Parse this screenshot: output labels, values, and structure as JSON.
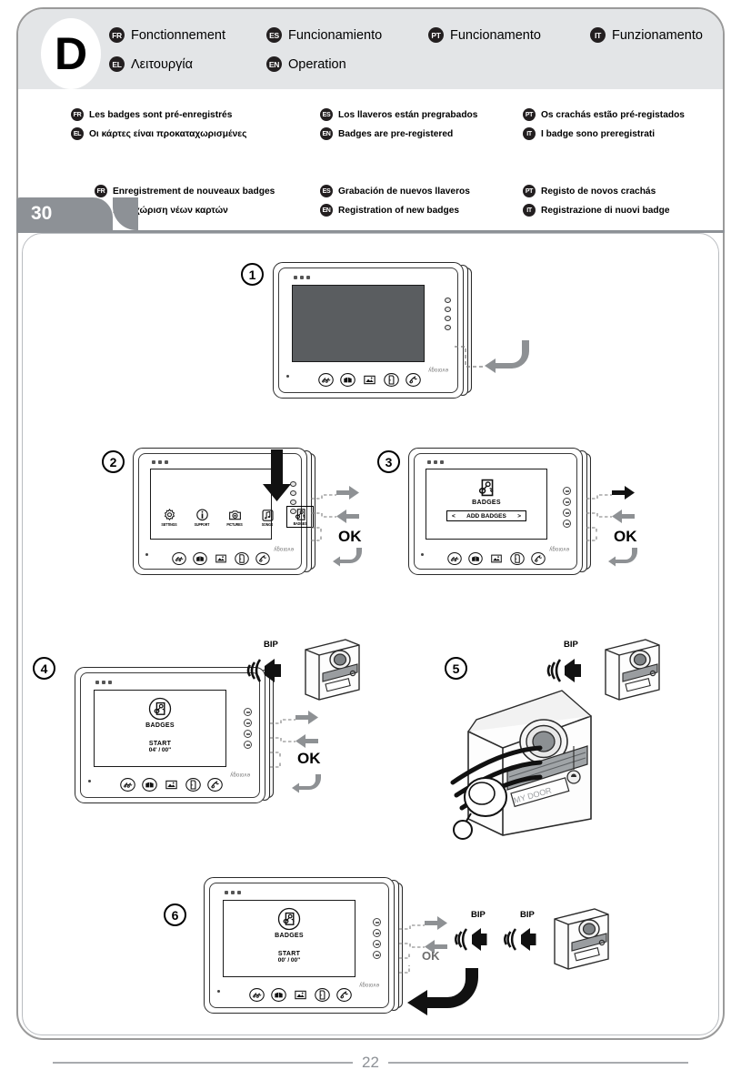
{
  "page": {
    "section_letter": "D",
    "tab_number": "30",
    "footer_page": "22"
  },
  "header": {
    "items": [
      {
        "lang": "FR",
        "label": "Fonctionnement"
      },
      {
        "lang": "ES",
        "label": "Funcionamiento"
      },
      {
        "lang": "PT",
        "label": "Funcionamento"
      },
      {
        "lang": "IT",
        "label": "Funzionamento"
      },
      {
        "lang": "EL",
        "label": "Λειτουργία"
      },
      {
        "lang": "EN",
        "label": "Operation"
      }
    ]
  },
  "subtitle_a": {
    "items": [
      {
        "lang": "FR",
        "label": "Les badges sont pré-enregistrés"
      },
      {
        "lang": "EL",
        "label": "Οι κάρτες είναι προκαταχωρισμένες"
      },
      {
        "lang": "ES",
        "label": "Los llaveros están pregrabados"
      },
      {
        "lang": "EN",
        "label": "Badges are pre-registered"
      },
      {
        "lang": "PT",
        "label": "Os crachás estão pré-registados"
      },
      {
        "lang": "IT",
        "label": "I badge sono preregistrati"
      }
    ]
  },
  "subtitle_b": {
    "items": [
      {
        "lang": "FR",
        "label": "Enregistrement de nouveaux badges"
      },
      {
        "lang": "EL",
        "label": "Καταχώριση νέων καρτών"
      },
      {
        "lang": "ES",
        "label": "Grabación de nuevos llaveros"
      },
      {
        "lang": "EN",
        "label": "Registration of new badges"
      },
      {
        "lang": "PT",
        "label": "Registo de novos crachás"
      },
      {
        "lang": "IT",
        "label": "Registrazione di nuovi badge"
      }
    ]
  },
  "steps": {
    "s1": {
      "number": "1"
    },
    "s2": {
      "number": "2",
      "ok_label": "OK",
      "menu": [
        {
          "icon": "gear-icon",
          "label": "SETTINGS"
        },
        {
          "icon": "info-icon",
          "label": "SUPPORT"
        },
        {
          "icon": "camera-icon",
          "label": "PICTURES"
        },
        {
          "icon": "music-note-icon",
          "label": "SONGS"
        },
        {
          "icon": "badge-icon",
          "label": "BADGES"
        }
      ],
      "selected": "BADGES"
    },
    "s3": {
      "number": "3",
      "screen_title": "BADGES",
      "action_label": "ADD BADGES",
      "prev_arrow": "<",
      "next_arrow": ">",
      "ok_label": "OK"
    },
    "s4": {
      "number": "4",
      "screen_title": "BADGES",
      "start_label": "START",
      "timer": "04' / 00\"",
      "ok_label": "OK",
      "bip": "BIP"
    },
    "s5": {
      "number": "5",
      "bip": "BIP",
      "door_label": "MY DOOR"
    },
    "s6": {
      "number": "6",
      "screen_title": "BADGES",
      "start_label": "START",
      "timer": "00' / 00\"",
      "ok_label": "OK",
      "bip1": "BIP",
      "bip2": "BIP"
    }
  },
  "monitor": {
    "brand": "evology",
    "buttons": [
      "intercom-icon",
      "gate-icon",
      "image-icon",
      "door-icon",
      "phone-icon"
    ]
  },
  "colors": {
    "header_bg": "#e3e5e7",
    "tab_gray": "#8d9196",
    "arrow_gray": "#8e9194",
    "arrow_black": "#111111",
    "screen_dark": "#5a5d60",
    "chip_black": "#231f20"
  }
}
